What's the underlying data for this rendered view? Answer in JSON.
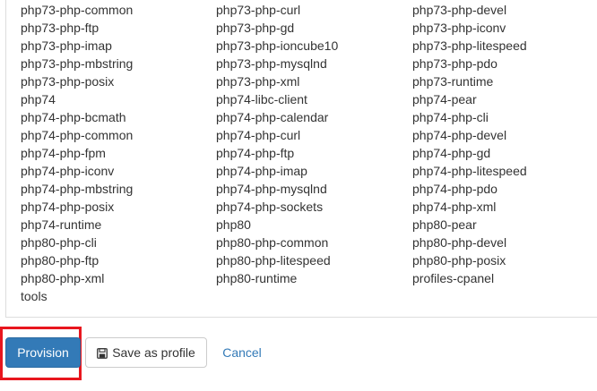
{
  "packages": [
    "php73-php-common",
    "php73-php-curl",
    "php73-php-devel",
    "php73-php-ftp",
    "php73-php-gd",
    "php73-php-iconv",
    "php73-php-imap",
    "php73-php-ioncube10",
    "php73-php-litespeed",
    "php73-php-mbstring",
    "php73-php-mysqlnd",
    "php73-php-pdo",
    "php73-php-posix",
    "php73-php-xml",
    "php73-runtime",
    "php74",
    "php74-libc-client",
    "php74-pear",
    "php74-php-bcmath",
    "php74-php-calendar",
    "php74-php-cli",
    "php74-php-common",
    "php74-php-curl",
    "php74-php-devel",
    "php74-php-fpm",
    "php74-php-ftp",
    "php74-php-gd",
    "php74-php-iconv",
    "php74-php-imap",
    "php74-php-litespeed",
    "php74-php-mbstring",
    "php74-php-mysqlnd",
    "php74-php-pdo",
    "php74-php-posix",
    "php74-php-sockets",
    "php74-php-xml",
    "php74-runtime",
    "php80",
    "php80-pear",
    "php80-php-cli",
    "php80-php-common",
    "php80-php-devel",
    "php80-php-ftp",
    "php80-php-litespeed",
    "php80-php-posix",
    "php80-php-xml",
    "php80-runtime",
    "profiles-cpanel",
    "tools"
  ],
  "actions": {
    "provision_label": "Provision",
    "save_profile_label": "Save as profile",
    "save_profile_icon": "floppy-disk-icon",
    "cancel_label": "Cancel"
  },
  "colors": {
    "primary": "#337ab7",
    "highlight": "#e8161e",
    "text": "#333333"
  }
}
